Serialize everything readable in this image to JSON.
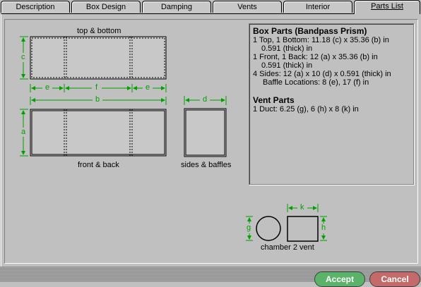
{
  "tabs": [
    {
      "label": "Description"
    },
    {
      "label": "Box Design"
    },
    {
      "label": "Damping"
    },
    {
      "label": "Vents"
    },
    {
      "label": "Interior"
    },
    {
      "label": "Parts List",
      "active": true
    }
  ],
  "diagram": {
    "top_bottom_label": "top & bottom",
    "front_back_label": "front & back",
    "sides_baffles_label": "sides & baffles",
    "chamber_vent_label": "chamber 2 vent",
    "dims": {
      "c": "c",
      "e1": "e",
      "f": "f",
      "e2": "e",
      "b": "b",
      "a": "a",
      "d": "d",
      "g": "g",
      "k": "k",
      "h": "h"
    },
    "dim_color": "#00a000"
  },
  "parts": {
    "box_heading": "Box Parts (Bandpass Prism)",
    "line1": "1 Top, 1 Bottom:  11.18 (c) x 35.36 (b) in",
    "line1b": "0.591 (thick) in",
    "line2": "1 Front, 1 Back:  12 (a) x 35.36 (b) in",
    "line2b": "0.591 (thick) in",
    "line3": "4 Sides:  12 (a) x 10 (d) x 0.591 (thick) in",
    "line3b": "Baffle Locations: 8 (e), 17 (f) in",
    "vent_heading": "Vent Parts",
    "line4": "1 Duct:  6.25 (g), 6 (h) x 8 (k) in"
  },
  "buttons": {
    "accept": "Accept",
    "cancel": "Cancel"
  },
  "colors": {
    "accept": "#5bb36a",
    "cancel": "#c46a6a"
  }
}
